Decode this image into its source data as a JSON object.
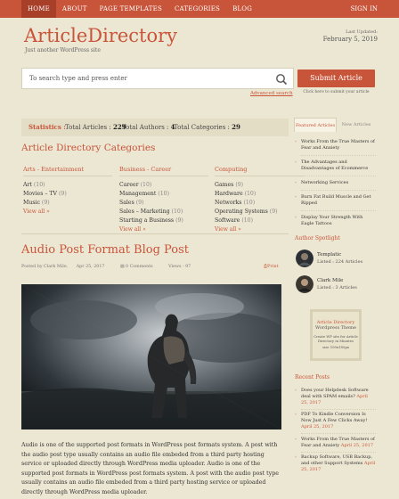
{
  "nav": {
    "items": [
      "HOME",
      "ABOUT",
      "PAGE TEMPLATES",
      "CATEGORIES",
      "BLOG"
    ],
    "signin": "SIGN IN"
  },
  "header": {
    "logo": "ArticleDirectory",
    "tagline": "Just another WordPress site",
    "updated_label": "Last Updated:",
    "updated_date": "February 5, 2019"
  },
  "search": {
    "placeholder": "To search type and press enter",
    "advanced": "Advanced search",
    "submit_label": "Submit Article",
    "submit_note": "Click here to submit your article"
  },
  "stats": {
    "title": "Statistics :",
    "articles_label": "Total Articles :",
    "articles": "229",
    "authors_label": "Total Authors :",
    "authors": "4",
    "categories_label": "Total Categories :",
    "categories": "29"
  },
  "categories": {
    "title": "Article Directory Categories",
    "columns": [
      {
        "heading": "Arts - Entertainment",
        "items": [
          [
            "Art",
            "(10)"
          ],
          [
            "Movies – TV",
            "(9)"
          ],
          [
            "Music",
            "(9)"
          ]
        ],
        "view_all": "View all »"
      },
      {
        "heading": "Business - Career",
        "items": [
          [
            "Career",
            "(10)"
          ],
          [
            "Management",
            "(10)"
          ],
          [
            "Sales",
            "(9)"
          ],
          [
            "Sales – Marketing",
            "(10)"
          ],
          [
            "Starting a Business",
            "(9)"
          ]
        ],
        "view_all": "View all »"
      },
      {
        "heading": "Computing",
        "items": [
          [
            "Games",
            "(9)"
          ],
          [
            "Hardware",
            "(10)"
          ],
          [
            "Networks",
            "(10)"
          ],
          [
            "Operating Systems",
            "(9)"
          ],
          [
            "Software",
            "(10)"
          ]
        ],
        "view_all": "View all »"
      }
    ]
  },
  "post": {
    "title": "Audio Post Format Blog Post",
    "author": "Posted by Clark Mile,",
    "date": "Apr 25, 2017",
    "comments": "0 Comments",
    "views": "Views - 97",
    "print": "Print",
    "body": "Audio is one of the supported post formats in WordPress post formats system. A post with the audio post type usually contains an audio file embeded from a third party hosting service or uploaded directly through WordPress media uploader. Audio is one of the supported post formats in WordPress post formats system. A post with the audio post type usually contains an audio file embeded from a third party hosting service or uploaded directly through WordPress media uploader."
  },
  "sidebar": {
    "tab_active": "Featured Articles",
    "tab_inactive": "New Articles",
    "featured": [
      "Works From the True Masters of Fear and Anxiety",
      "The Advantages and Disadvantages of Ecommerce",
      "Networking Services",
      "Burn Fat Build Muscle and Get Ripped",
      "Display Your Strength With Eagle Tattoos"
    ],
    "spotlight_title": "Author Spotlight",
    "authors": [
      {
        "name": "Templatic",
        "count": "Listed : 224 Articles"
      },
      {
        "name": "Clark Mile",
        "count": "Listed : 3 Articles"
      }
    ],
    "ad": {
      "line1": "Article Directory",
      "line2": "Wordpress Theme",
      "line3": "Create WP site for Article Directory in Minutes",
      "size": "size 100x185px"
    },
    "recent_title": "Recent Posts",
    "recent": [
      {
        "title": "Does your Helpdesk Software deal with SPAM emails?",
        "date": "April 25, 2017"
      },
      {
        "title": "PDF To Kindle Conversion Is Now Just A Few Clicks Away!",
        "date": "April 25, 2017"
      },
      {
        "title": "Works From the True Masters of Fear and Anxiety",
        "date": "April 25, 2017"
      },
      {
        "title": "Backup Software, USB Backup, and other Support Systems",
        "date": "April 25, 2017"
      }
    ]
  },
  "colors": {
    "accent": "#c8543a",
    "background": "#ece7d3"
  }
}
